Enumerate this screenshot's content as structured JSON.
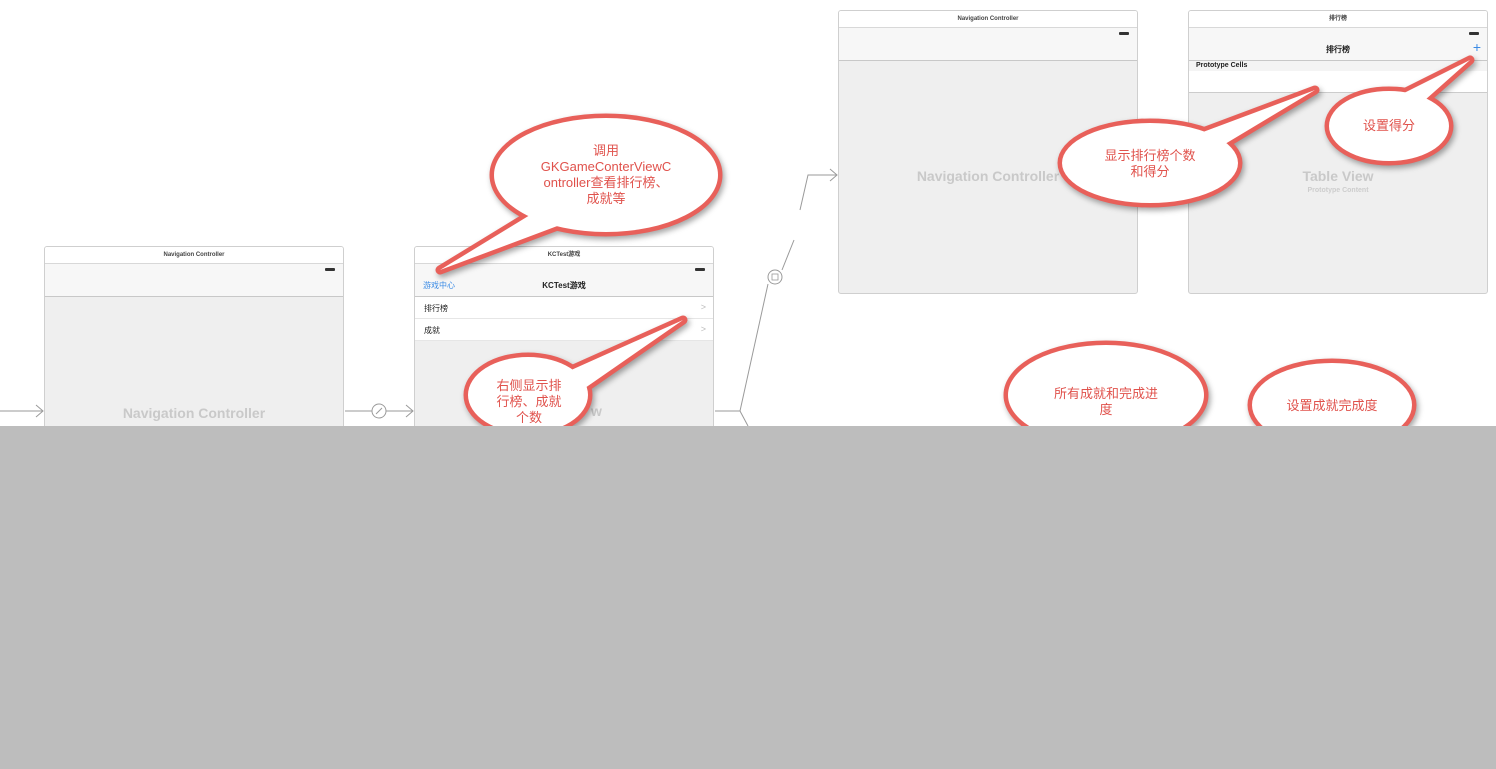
{
  "scenes": {
    "nav1": {
      "title_bar": "Navigation Controller",
      "body_label": "Navigation Controller"
    },
    "kctest": {
      "title_bar": "KCTest游戏",
      "nav_title": "KCTest游戏",
      "nav_left_button": "游戏中心",
      "rows": [
        {
          "label": "排行榜"
        },
        {
          "label": "成就"
        }
      ],
      "body_label_partial": "w"
    },
    "nav2": {
      "title_bar": "Navigation Controller",
      "body_label": "Navigation Controller"
    },
    "leaderboard": {
      "title_bar": "排行榜",
      "nav_title": "排行榜",
      "nav_right_button": "+",
      "section_header": "Prototype Cells",
      "body_label": "Table View",
      "body_sublabel": "Prototype Content"
    }
  },
  "callouts": [
    {
      "lines": [
        "调用",
        "GKGameConterViewC",
        "ontroller查看排行榜、",
        "成就等"
      ]
    },
    {
      "lines": [
        "右侧显示排",
        "行榜、成就",
        "个数"
      ]
    },
    {
      "lines": [
        "显示排行榜个数",
        "和得分"
      ]
    },
    {
      "lines": [
        "设置得分"
      ]
    },
    {
      "lines": [
        "所有成就和完成进",
        "度"
      ]
    },
    {
      "lines": [
        "设置成就完成度"
      ]
    }
  ],
  "icons": {
    "segue": "segue-circle-icon",
    "relationship": "relationship-circle-icon",
    "chevron": "chevron-right-icon"
  },
  "colors": {
    "callout_stroke": "#e8605a",
    "callout_text": "#e0524c",
    "link": "#3b8be5",
    "overlay": "#bdbdbd"
  }
}
